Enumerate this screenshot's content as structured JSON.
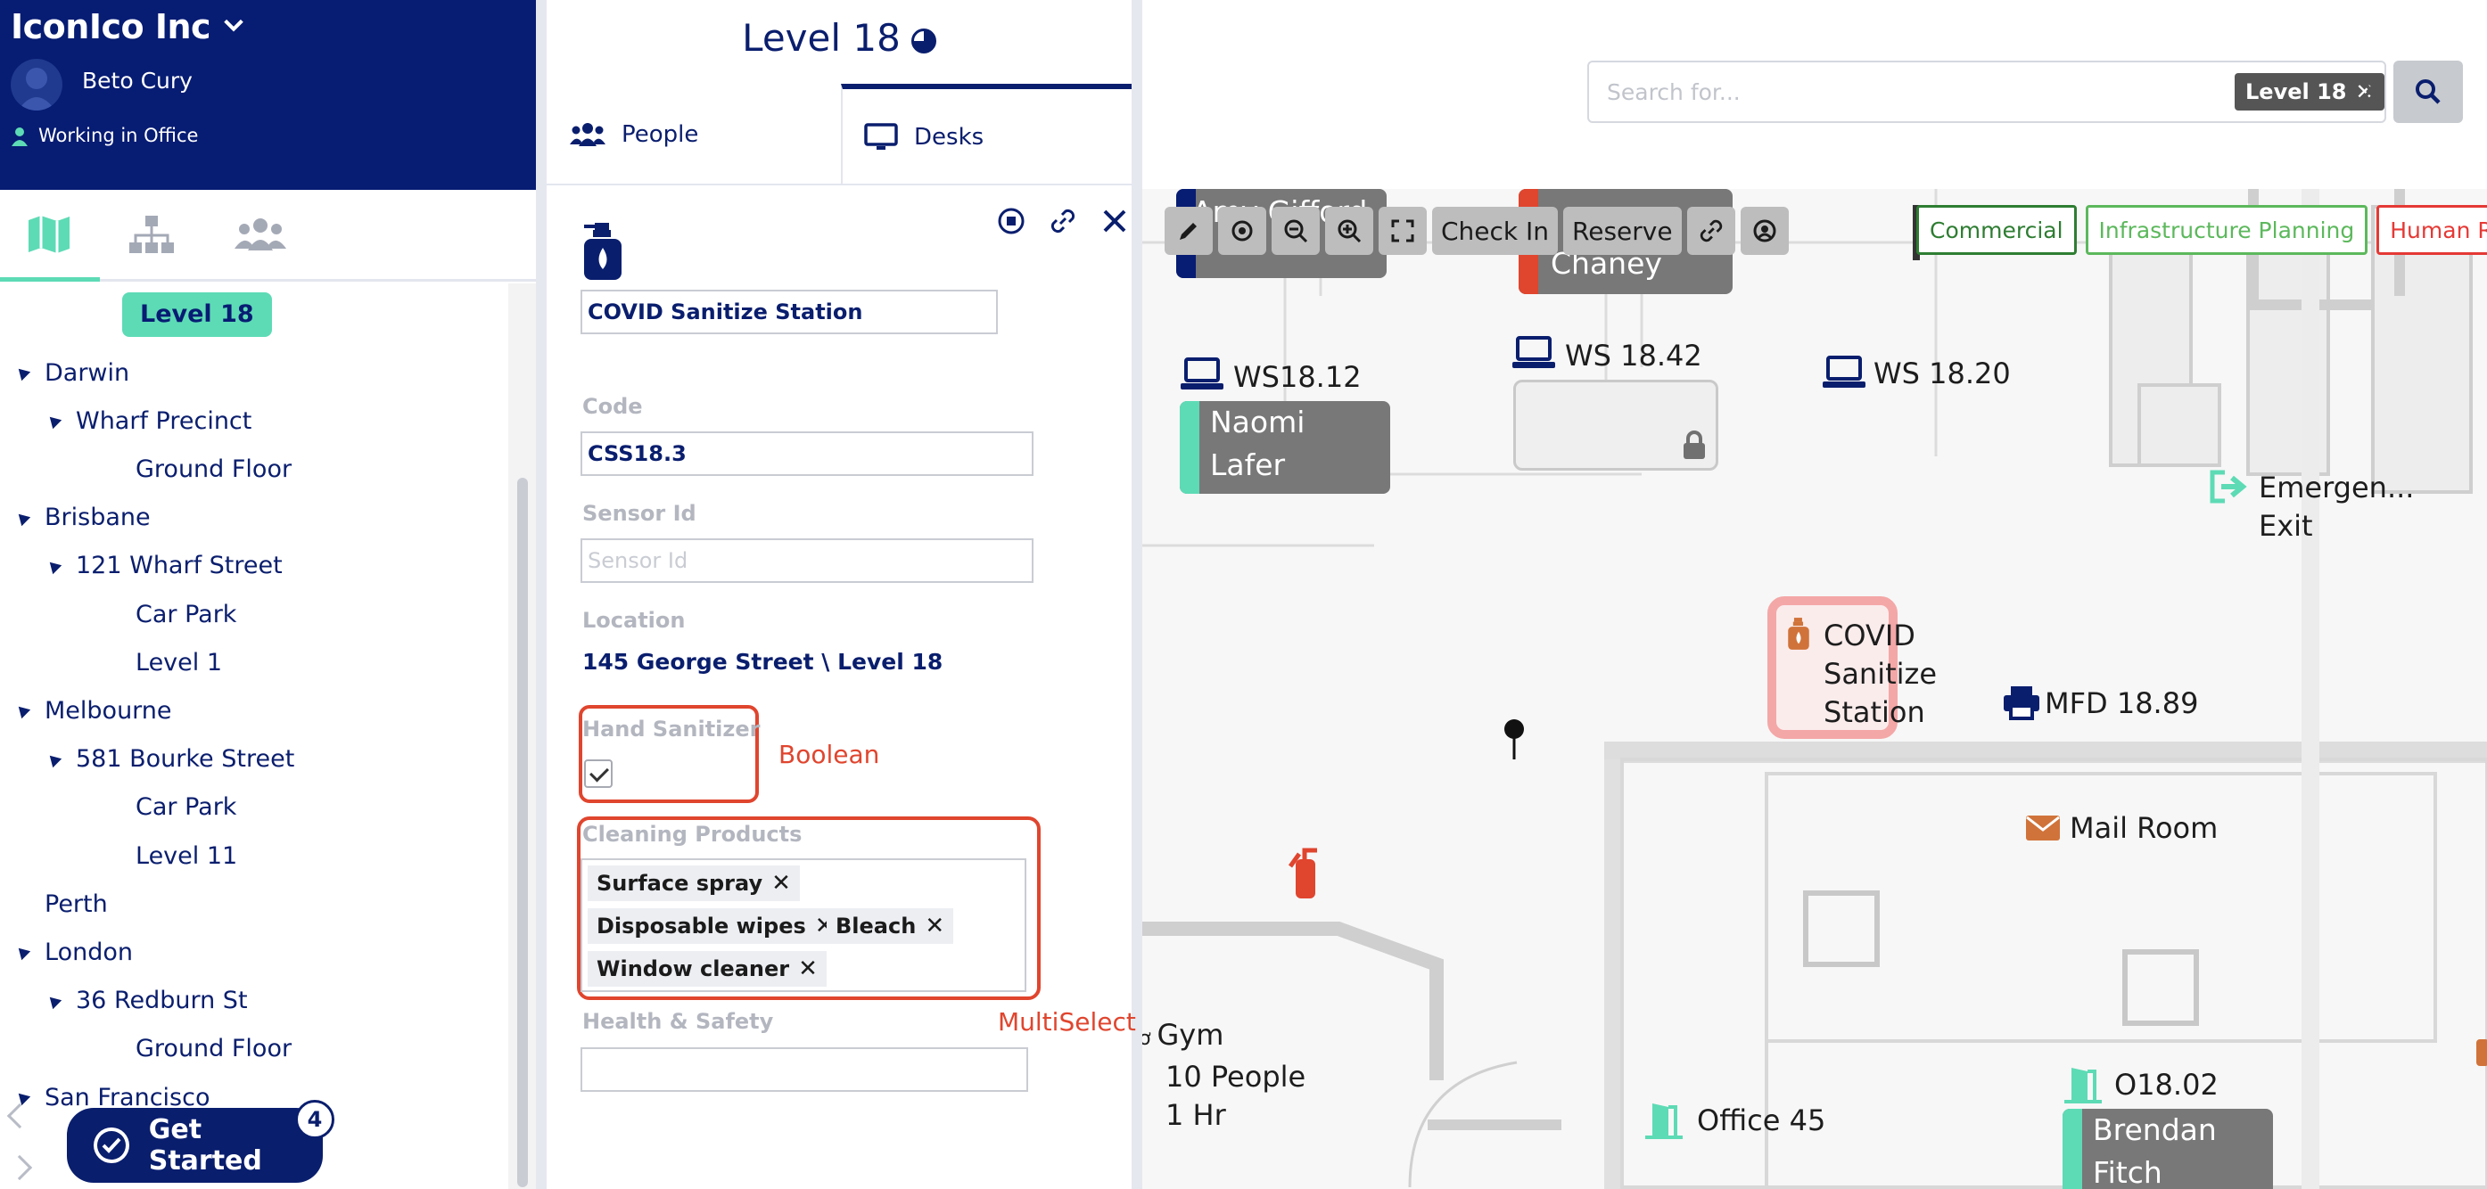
{
  "org": {
    "name": "IconIco Inc",
    "user_name": "Beto Cury",
    "status": "Working in Office"
  },
  "nav": {
    "tabs": [
      "map-icon",
      "org-chart-icon",
      "people-icon"
    ]
  },
  "tree": {
    "selected": "Level 18",
    "items": [
      {
        "label": "Darwin",
        "depth": 1,
        "caret": true
      },
      {
        "label": "Wharf Precinct",
        "depth": 2,
        "caret": true
      },
      {
        "label": "Ground Floor",
        "depth": 3,
        "caret": false
      },
      {
        "label": "Brisbane",
        "depth": 1,
        "caret": true
      },
      {
        "label": "121 Wharf Street",
        "depth": 2,
        "caret": true
      },
      {
        "label": "Car Park",
        "depth": 3,
        "caret": false
      },
      {
        "label": "Level 1",
        "depth": 3,
        "caret": false
      },
      {
        "label": "Melbourne",
        "depth": 1,
        "caret": true
      },
      {
        "label": "581 Bourke Street",
        "depth": 2,
        "caret": true
      },
      {
        "label": "Car Park",
        "depth": 3,
        "caret": false
      },
      {
        "label": "Level 11",
        "depth": 3,
        "caret": false
      },
      {
        "label": "Perth",
        "depth": 1,
        "caret": false
      },
      {
        "label": "London",
        "depth": 1,
        "caret": true
      },
      {
        "label": "36 Redburn St",
        "depth": 2,
        "caret": true
      },
      {
        "label": "Ground Floor",
        "depth": 3,
        "caret": false
      },
      {
        "label": "San Francisco",
        "depth": 1,
        "caret": true
      }
    ]
  },
  "get_started": {
    "label": "Get Started",
    "badge": "4"
  },
  "panel": {
    "title": "Level 18",
    "tabs": {
      "people": "People",
      "desks": "Desks"
    },
    "name_value": "COVID Sanitize Station",
    "code_label": "Code",
    "code_value": "CSS18.3",
    "sensor_label": "Sensor Id",
    "sensor_placeholder": "Sensor Id",
    "location_label": "Location",
    "location_value": "145 George Street \\ Level 18",
    "hand_sanitizer_label": "Hand Sanitizer",
    "hand_sanitizer_checked": true,
    "boolean_annotation": "Boolean",
    "cleaning_label": "Cleaning Products",
    "cleaning_chips": [
      "Surface spray",
      "Disposable wipes",
      "Bleach",
      "Window cleaner"
    ],
    "multiselect_annotation": "MultiSelect",
    "health_label": "Health & Safety"
  },
  "search": {
    "placeholder": "Search for...",
    "tag": "Level 18"
  },
  "toolbar": {
    "check_in": "Check In",
    "reserve": "Reserve"
  },
  "legend": [
    {
      "label": "Commercial",
      "color": "#2e7d32"
    },
    {
      "label": "Infrastructure Planning",
      "color": "#5cb85c"
    },
    {
      "label": "Human Re",
      "color": "#e53935"
    }
  ],
  "map": {
    "amy_card": "Amy Gifford",
    "chaney_card": "Chaney",
    "ws1812": "WS18.12",
    "naomi_card_1": "Naomi",
    "naomi_card_2": "Lafer",
    "ws1842": "WS 18.42",
    "ws1820": "WS 18.20",
    "emergency_1": "Emergen...",
    "emergency_2": "Exit",
    "covid_1": "COVID",
    "covid_2": "Sanitize",
    "covid_3": "Station",
    "mfd": "MFD 18.89",
    "mail": "Mail Room",
    "gym_1": "Gym",
    "gym_2": "10 People",
    "gym_3": "1 Hr",
    "office45": "Office 45",
    "o1802": "O18.02",
    "brendan_1": "Brendan",
    "brendan_2": "Fitch"
  },
  "colors": {
    "navy": "#071c73",
    "mint": "#5ddbb5",
    "annotation_red": "#e0452e",
    "orange_icon": "#d0733a"
  }
}
